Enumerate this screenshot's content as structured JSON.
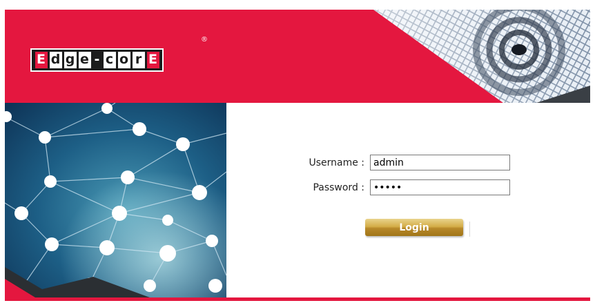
{
  "brand": {
    "logo_letters": [
      "E",
      "d",
      "g",
      "e",
      "-",
      "c",
      "o",
      "r",
      "E"
    ],
    "registered_mark": "®",
    "colors": {
      "primary_red": "#e4173f",
      "dark": "#1c1c1c",
      "button_gold": "#c99b35"
    }
  },
  "login_form": {
    "username_label": "Username :",
    "username_value": "admin",
    "password_label": "Password :",
    "password_value": "•••••",
    "login_button_label": "Login"
  },
  "imagery": {
    "header_graphic": "wireless-signal-grid-icon",
    "side_graphic": "network-nodes-illustration"
  }
}
